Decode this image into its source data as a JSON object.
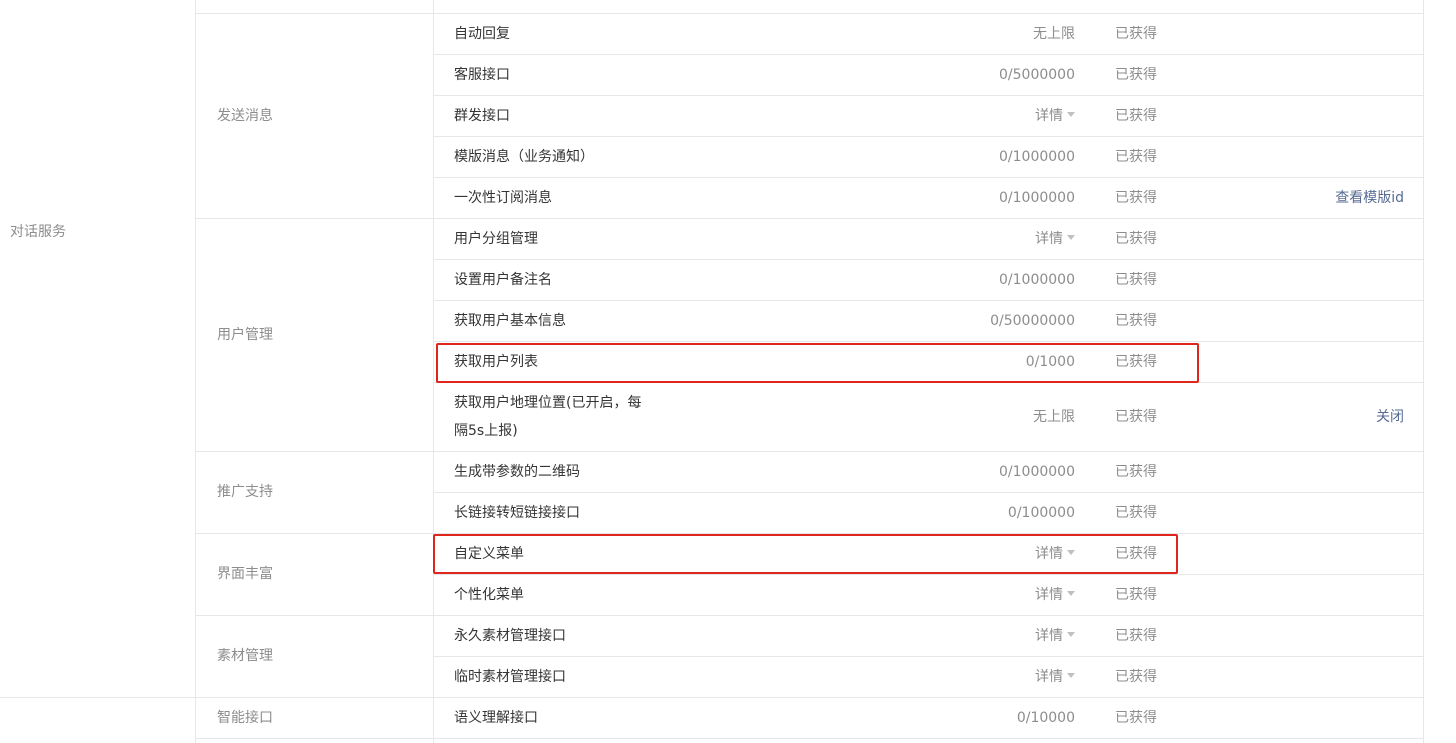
{
  "categories": [
    {
      "label": "对话服务"
    }
  ],
  "groups": [
    {
      "label": "发送消息"
    },
    {
      "label": "用户管理"
    },
    {
      "label": "推广支持"
    },
    {
      "label": "界面丰富"
    },
    {
      "label": "素材管理"
    },
    {
      "label": "智能接口"
    }
  ],
  "rows": [
    {
      "name": "自动回复",
      "quota": "无上限",
      "status": "已获得"
    },
    {
      "name": "客服接口",
      "quota": "0/5000000",
      "status": "已获得"
    },
    {
      "name": "群发接口",
      "quota": "详情",
      "status": "已获得",
      "has_detail": true
    },
    {
      "name": "模版消息（业务通知）",
      "quota": "0/1000000",
      "status": "已获得"
    },
    {
      "name": "一次性订阅消息",
      "quota": "0/1000000",
      "status": "已获得",
      "operation": "查看模版id"
    },
    {
      "name": "用户分组管理",
      "quota": "详情",
      "status": "已获得",
      "has_detail": true
    },
    {
      "name": "设置用户备注名",
      "quota": "0/1000000",
      "status": "已获得"
    },
    {
      "name": "获取用户基本信息",
      "quota": "0/50000000",
      "status": "已获得"
    },
    {
      "name": "获取用户列表",
      "quota": "0/1000",
      "status": "已获得",
      "highlighted": true
    },
    {
      "name_line1": "获取用户地理位置(已开启，每",
      "name_line2": "隔5s上报)",
      "quota": "无上限",
      "status": "已获得",
      "operation": "关闭"
    },
    {
      "name": "生成带参数的二维码",
      "quota": "0/1000000",
      "status": "已获得"
    },
    {
      "name": "长链接转短链接接口",
      "quota": "0/100000",
      "status": "已获得"
    },
    {
      "name": "自定义菜单",
      "quota": "详情",
      "status": "已获得",
      "has_detail": true,
      "highlighted": true
    },
    {
      "name": "个性化菜单",
      "quota": "详情",
      "status": "已获得",
      "has_detail": true
    },
    {
      "name": "永久素材管理接口",
      "quota": "详情",
      "status": "已获得",
      "has_detail": true
    },
    {
      "name": "临时素材管理接口",
      "quota": "详情",
      "status": "已获得",
      "has_detail": true
    },
    {
      "name": "语义理解接口",
      "quota": "0/10000",
      "status": "已获得"
    }
  ],
  "colors": {
    "border": "#e7e7eb",
    "label_gray": "#8d8d8d",
    "text_dark": "#353535",
    "link_blue": "#576b95",
    "highlight_red": "#e0251c"
  }
}
